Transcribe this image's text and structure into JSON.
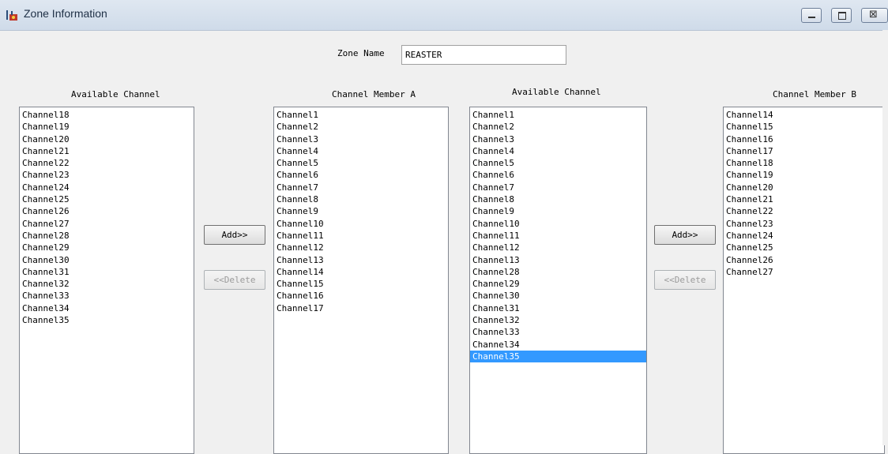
{
  "window": {
    "title": "Zone Information",
    "icon": "radio-app-icon",
    "controls": {
      "minimize": "minimize-icon",
      "maximize": "maximize-icon",
      "close": "close-icon",
      "close_glyph": "⊠"
    }
  },
  "zone": {
    "label": "Zone Name",
    "value": "REASTER"
  },
  "group_a": {
    "available_header": "Available Channel",
    "available": [
      "Channel18",
      "Channel19",
      "Channel20",
      "Channel21",
      "Channel22",
      "Channel23",
      "Channel24",
      "Channel25",
      "Channel26",
      "Channel27",
      "Channel28",
      "Channel29",
      "Channel30",
      "Channel31",
      "Channel32",
      "Channel33",
      "Channel34",
      "Channel35"
    ],
    "member_header": "Channel Member A",
    "members": [
      "Channel1",
      "Channel2",
      "Channel3",
      "Channel4",
      "Channel5",
      "Channel6",
      "Channel7",
      "Channel8",
      "Channel9",
      "Channel10",
      "Channel11",
      "Channel12",
      "Channel13",
      "Channel14",
      "Channel15",
      "Channel16",
      "Channel17"
    ],
    "add_label": "Add>>",
    "delete_label": "<<Delete"
  },
  "group_b": {
    "available_header": "Available Channel",
    "available": [
      "Channel1",
      "Channel2",
      "Channel3",
      "Channel4",
      "Channel5",
      "Channel6",
      "Channel7",
      "Channel8",
      "Channel9",
      "Channel10",
      "Channel11",
      "Channel12",
      "Channel13",
      "Channel28",
      "Channel29",
      "Channel30",
      "Channel31",
      "Channel32",
      "Channel33",
      "Channel34",
      "Channel35"
    ],
    "selected_available": "Channel35",
    "member_header": "Channel Member B",
    "members": [
      "Channel14",
      "Channel15",
      "Channel16",
      "Channel17",
      "Channel18",
      "Channel19",
      "Channel20",
      "Channel21",
      "Channel22",
      "Channel23",
      "Channel24",
      "Channel25",
      "Channel26",
      "Channel27"
    ],
    "add_label": "Add>>",
    "delete_label": "<<Delete"
  },
  "colors": {
    "selection": "#3399ff",
    "list_background": "#ffffff",
    "window_background": "#f0f0f0"
  }
}
